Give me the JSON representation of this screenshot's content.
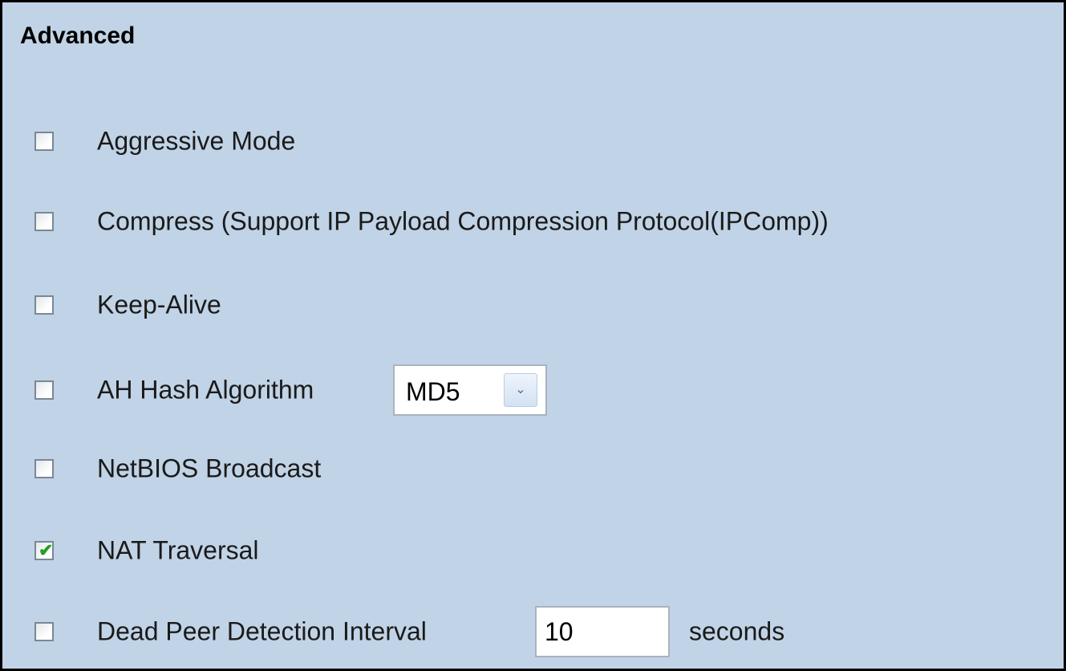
{
  "section": {
    "title": "Advanced"
  },
  "options": {
    "aggressive_mode": {
      "label": "Aggressive Mode",
      "checked": false
    },
    "compress": {
      "label": "Compress (Support IP Payload Compression Protocol(IPComp))",
      "checked": false
    },
    "keep_alive": {
      "label": "Keep-Alive",
      "checked": false
    },
    "ah_hash": {
      "label": "AH Hash Algorithm",
      "checked": false,
      "selected": "MD5",
      "dropdown_icon": "chevron-down-icon"
    },
    "netbios": {
      "label": "NetBIOS Broadcast",
      "checked": false
    },
    "nat_traversal": {
      "label": "NAT Traversal",
      "checked": true,
      "check_glyph": "✔"
    },
    "dpd": {
      "label": "Dead Peer Detection Interval",
      "checked": false,
      "value": "10",
      "suffix": "seconds"
    }
  },
  "colors": {
    "background": "#c1d3e6",
    "check": "#21a121",
    "border": "#000000"
  }
}
